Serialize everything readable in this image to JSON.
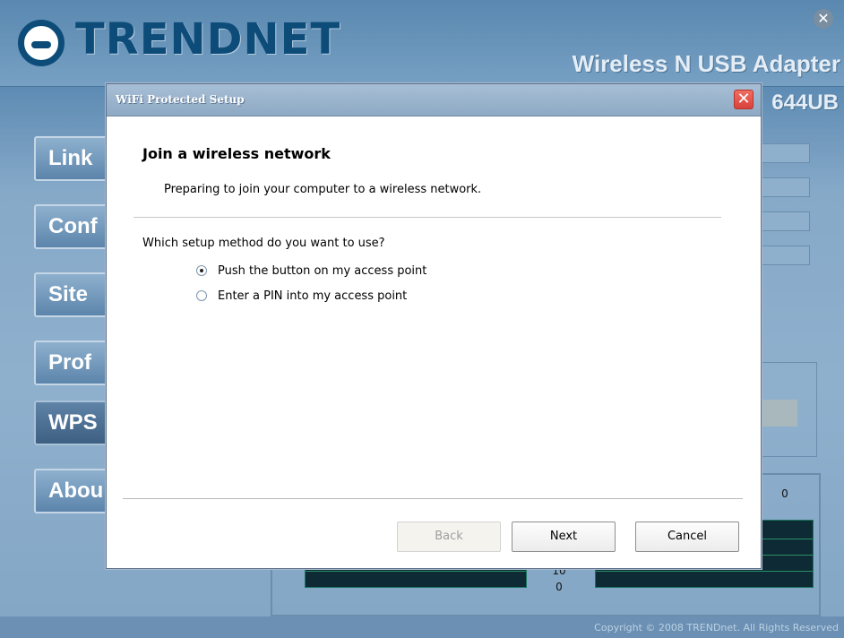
{
  "app": {
    "brand": "TRENDNET",
    "product_title": "Wireless N USB Adapter",
    "model": "644UB",
    "copyright": "Copyright © 2008 TRENDnet. All Rights Reserved",
    "nav": [
      {
        "label": "Link"
      },
      {
        "label": "Conf"
      },
      {
        "label": "Site"
      },
      {
        "label": "Prof"
      },
      {
        "label": "WPS"
      },
      {
        "label": "Abou"
      }
    ],
    "graph": {
      "top_value": "0",
      "mid_value": "10",
      "bottom_value": "0"
    }
  },
  "dialog": {
    "title": "WiFi Protected Setup",
    "heading": "Join a wireless network",
    "description": "Preparing to join your computer to a wireless network.",
    "question": "Which setup method do you want to use?",
    "options": [
      {
        "label": "Push the button on my access point",
        "selected": true
      },
      {
        "label": "Enter a PIN into my access point",
        "selected": false
      }
    ],
    "buttons": {
      "back": "Back",
      "next": "Next",
      "cancel": "Cancel"
    }
  },
  "colors": {
    "accent": "#0d4c79",
    "title_bar": "#8ea9c4",
    "graph_bg": "#0d2a35",
    "graph_line": "#2c8f64",
    "close_button": "#d8433b"
  },
  "icons": {
    "app_close": "close-icon",
    "dialog_close": "close-icon",
    "logo": "trendnet-logo-icon"
  }
}
